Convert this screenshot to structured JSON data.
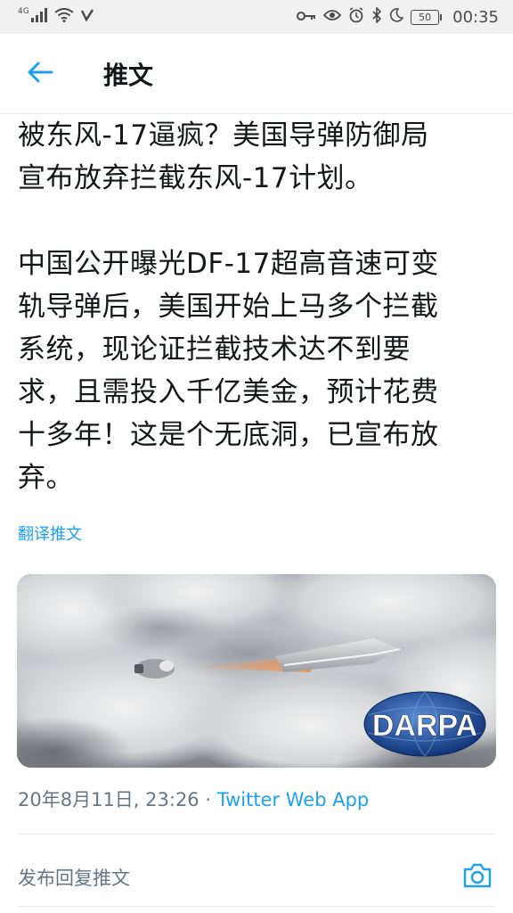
{
  "status_bar": {
    "network": "4G",
    "time": "00:35",
    "battery": "50",
    "icons": [
      "signal-icon",
      "wifi-icon",
      "v-icon",
      "key-icon",
      "eye-icon",
      "alarm-icon",
      "bluetooth-icon",
      "moon-icon",
      "battery-icon"
    ]
  },
  "header": {
    "back_icon": "back-arrow-icon",
    "title": "推文"
  },
  "tweet": {
    "paragraph1": [
      "被东风-17逼疯？美国导弹防御局",
      "宣布放弃拦截东风-17计划。"
    ],
    "paragraph2": [
      "中国公开曝光DF-17超高音速可变",
      "轨导弹后，美国开始上马多个拦截",
      "系统，现论证拦截技术达不到要",
      "求，且需投入千亿美金，预计花费",
      "十多年！这是个无底洞，已宣布放",
      "弃。"
    ],
    "translate": "翻译推文",
    "media_logo": "DARPA",
    "date": "20年8月11日, 23:26",
    "separator": " · ",
    "app": "Twitter Web App"
  },
  "reply": {
    "placeholder": "发布回复推文",
    "camera_icon": "camera-icon"
  },
  "colors": {
    "accent": "#1da1f2",
    "text": "#14171a",
    "secondary": "#657786",
    "statusbar_bg": "#f1f1f1"
  }
}
